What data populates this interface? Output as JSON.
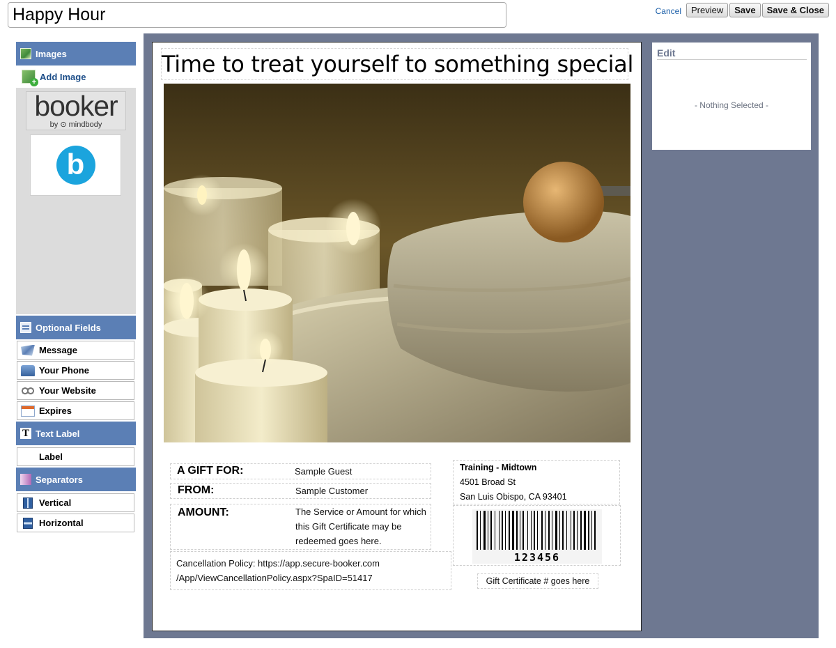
{
  "top": {
    "title_value": "Happy Hour",
    "cancel": "Cancel",
    "preview": "Preview",
    "save": "Save",
    "save_close": "Save & Close"
  },
  "sidebar": {
    "images_header": "Images",
    "add_image": "Add Image",
    "thumb_booker_word": "booker",
    "thumb_booker_by": "by ⊙ mindbody",
    "thumb_b_letter": "b",
    "optional_header": "Optional Fields",
    "optional_items": [
      "Message",
      "Your Phone",
      "Your Website",
      "Expires"
    ],
    "text_label_header": "Text Label",
    "text_label_item": "Label",
    "separators_header": "Separators",
    "separator_items": [
      "Vertical",
      "Horizontal"
    ]
  },
  "certificate": {
    "title": "Time to treat yourself to something special",
    "gift_for_label": "A GIFT FOR:",
    "gift_for_value": "Sample Guest",
    "from_label": "FROM:",
    "from_value": "Sample Customer",
    "amount_label": "AMOUNT:",
    "amount_value_lines": [
      "The Service or Amount for which",
      "this Gift Certificate may be",
      "redeemed goes here."
    ],
    "cancellation_lines": [
      "Cancellation Policy: https://app.secure-booker.com",
      "/App/ViewCancellationPolicy.aspx?SpaID=51417"
    ],
    "location_name": "Training - Midtown",
    "address_line1": "4501 Broad St",
    "address_line2": "San Luis Obispo, CA 93401",
    "barcode_number": "123456",
    "cert_number": "Gift Certificate # goes here"
  },
  "edit_panel": {
    "title": "Edit",
    "empty": "- Nothing Selected -"
  },
  "colors": {
    "header_blue": "#5b7fb5",
    "canvas_bg": "#6e7891",
    "link_blue": "#1a5ea8"
  }
}
